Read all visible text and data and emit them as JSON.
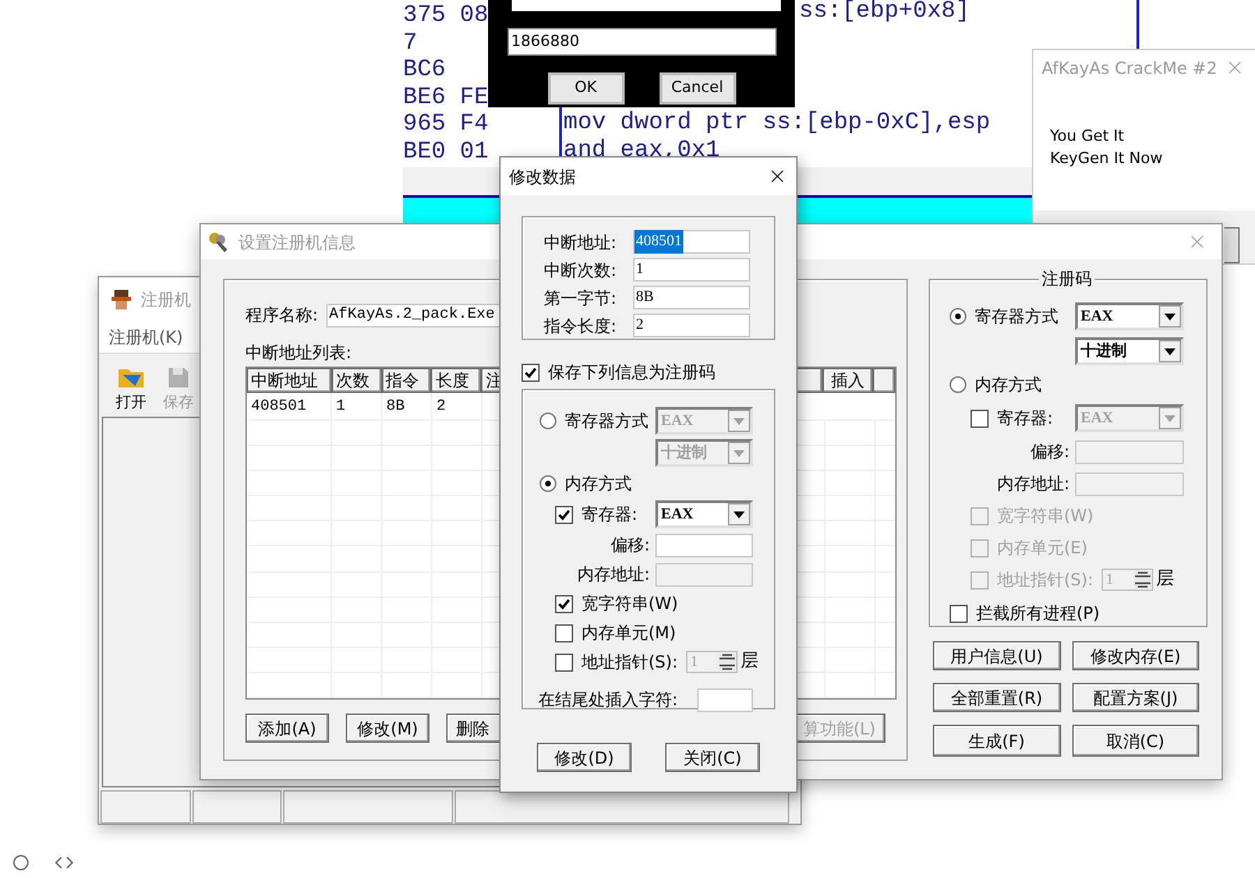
{
  "debugger": {
    "hex": [
      "375 08",
      "7",
      "BC6",
      "BE6 FE",
      "965 F4",
      "BE0 01"
    ],
    "top_code": "ss:[ebp+0x8]",
    "code": [
      "mov dword ptr ss:[ebp-0xC],esp",
      "and eax,0x1"
    ]
  },
  "input_dialog": {
    "value": "1866880",
    "buttons": [
      "OK",
      "Cancel"
    ]
  },
  "crackme": {
    "title": "AfKayAs CrackMe #2",
    "lines": [
      "You Get It",
      "KeyGen It Now"
    ]
  },
  "main_window": {
    "title": "注册机",
    "menu": [
      "注册机(K)"
    ],
    "toolbar": [
      {
        "label": "打开",
        "disabled": false
      },
      {
        "label": "保存",
        "disabled": true
      }
    ]
  },
  "settings": {
    "title": "设置注册机信息",
    "program_name": {
      "label": "程序名称:",
      "value": "AfKayAs.2_pack.Exe"
    },
    "list_label": "中断地址列表:",
    "table": {
      "columns": [
        "中断地址",
        "次数",
        "指令",
        "长度",
        "注"
      ],
      "columns_right": [
        "插入"
      ],
      "rows": [
        [
          "408501",
          "1",
          "8B",
          "2"
        ]
      ]
    },
    "list_buttons": [
      {
        "label": "添加(A)",
        "disabled": false
      },
      {
        "label": "修改(M)",
        "disabled": false
      },
      {
        "label": "删除",
        "disabled": false
      },
      {
        "label": "算功能(L)",
        "disabled": true
      }
    ],
    "registration": {
      "title": "注册码",
      "register_mode": {
        "label": "寄存器方式",
        "selected": true
      },
      "register_select": {
        "value": "EAX",
        "disabled": false
      },
      "base_select": {
        "value": "十进制",
        "disabled": false
      },
      "memory_mode": {
        "label": "内存方式",
        "selected": false
      },
      "mem_register": {
        "label": "寄存器:",
        "checked": false,
        "disabled": false
      },
      "mem_register_select": {
        "value": "EAX",
        "disabled": true
      },
      "offset": {
        "label": "偏移:",
        "disabled": true
      },
      "address": {
        "label": "内存地址:",
        "disabled": true
      },
      "options": [
        {
          "label": "宽字符串(W)",
          "checked": false,
          "disabled": true
        },
        {
          "label": "内存单元(E)",
          "checked": false,
          "disabled": true
        },
        {
          "label": "地址指针(S):",
          "checked": false,
          "disabled": true,
          "spinner": {
            "value": "1",
            "disabled": true
          },
          "unit": "层"
        }
      ],
      "intercept": {
        "label": "拦截所有进程(P)",
        "checked": false,
        "disabled": false
      }
    },
    "buttons": [
      "用户信息(U)",
      "修改内存(E)",
      "全部重置(R)",
      "配置方案(J)",
      "生成(F)",
      "取消(C)"
    ]
  },
  "modify": {
    "title": "修改数据",
    "fields": [
      {
        "label": "中断地址:",
        "value": "408501",
        "selected": true
      },
      {
        "label": "中断次数:",
        "value": "1",
        "selected": false
      },
      {
        "label": "第一字节:",
        "value": "8B",
        "selected": false
      },
      {
        "label": "指令长度:",
        "value": "2",
        "selected": false
      }
    ],
    "save": {
      "label": "保存下列信息为注册码",
      "checked": true
    },
    "registration": {
      "register_mode": {
        "label": "寄存器方式",
        "selected": false
      },
      "register_select": {
        "value": "EAX",
        "disabled": true
      },
      "base_select": {
        "value": "十进制",
        "disabled": true
      },
      "memory_mode": {
        "label": "内存方式",
        "selected": true
      },
      "mem_register": {
        "label": "寄存器:",
        "checked": true,
        "disabled": false
      },
      "mem_register_select": {
        "value": "EAX",
        "disabled": false
      },
      "offset": {
        "label": "偏移:",
        "disabled": false
      },
      "address": {
        "label": "内存地址:",
        "disabled": true
      },
      "options": [
        {
          "label": "宽字符串(W)",
          "checked": true,
          "disabled": false
        },
        {
          "label": "内存单元(M)",
          "checked": false,
          "disabled": false
        },
        {
          "label": "地址指针(S):",
          "checked": false,
          "disabled": false,
          "spinner": {
            "value": "1",
            "disabled": true
          },
          "unit": "层"
        }
      ],
      "insert": {
        "label": "在结尾处插入字符:"
      }
    },
    "buttons": [
      "修改(D)",
      "关闭(C)"
    ]
  }
}
